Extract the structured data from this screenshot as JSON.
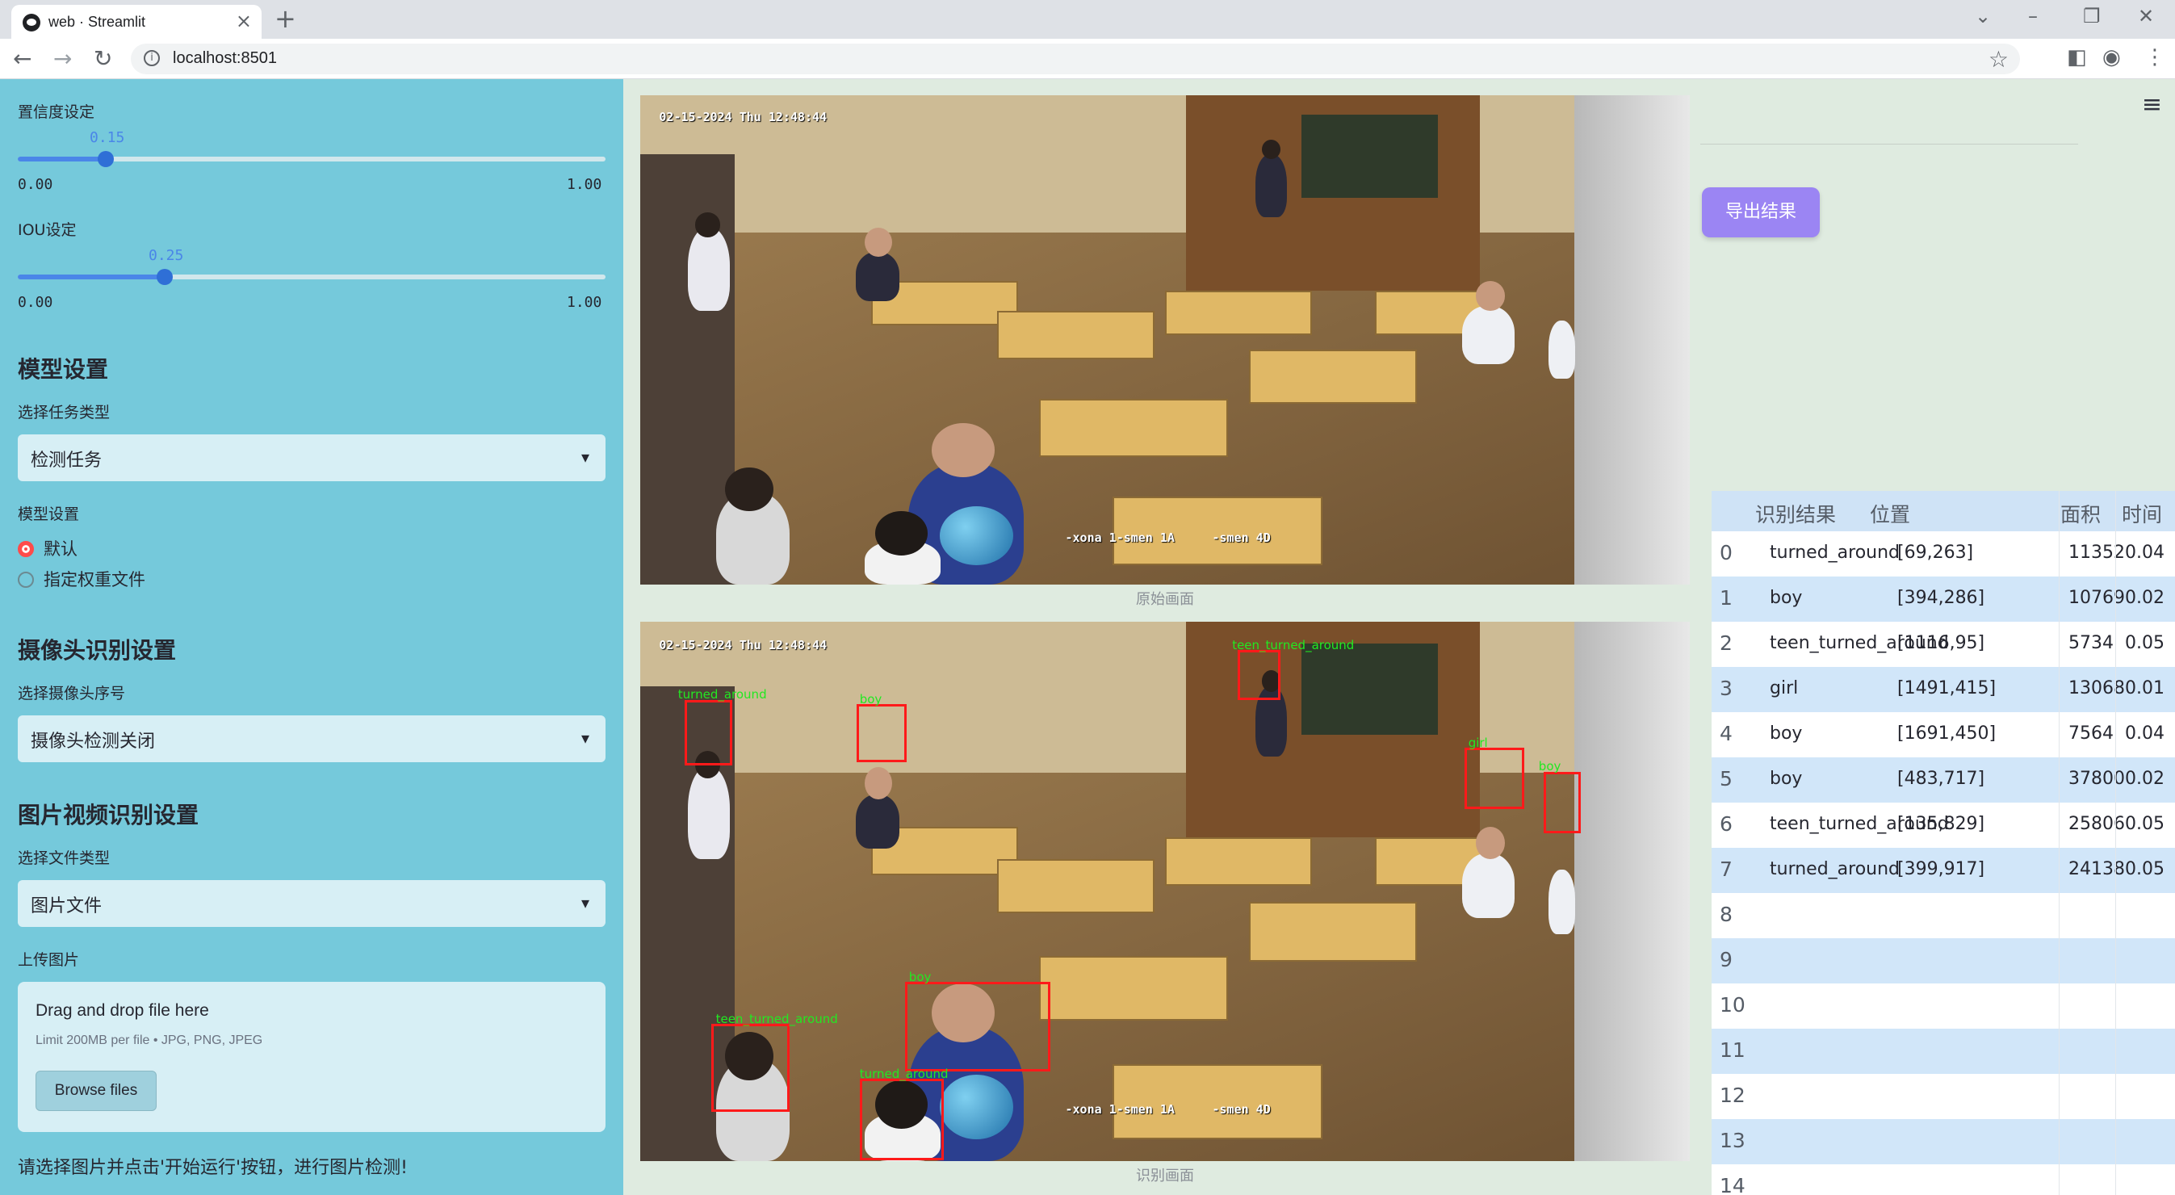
{
  "browser": {
    "tab_title": "web · Streamlit",
    "url": "localhost:8501"
  },
  "sidebar": {
    "conf_label": "置信度设定",
    "conf_value": "0.15",
    "conf_value_num": 0.15,
    "conf_min": "0.00",
    "conf_max": "1.00",
    "iou_label": "IOU设定",
    "iou_value": "0.25",
    "iou_value_num": 0.25,
    "iou_min": "0.00",
    "iou_max": "1.00",
    "model_heading": "模型设置",
    "task_label": "选择任务类型",
    "task_value": "检测任务",
    "model_label": "模型设置",
    "radio_default": "默认",
    "radio_custom": "指定权重文件",
    "camera_heading": "摄像头识别设置",
    "camera_label": "选择摄像头序号",
    "camera_value": "摄像头检测关闭",
    "media_heading": "图片视频识别设置",
    "filetype_label": "选择文件类型",
    "filetype_value": "图片文件",
    "upload_label": "上传图片",
    "upload_title": "Drag and drop file here",
    "upload_sub": "Limit 200MB per file • JPG, PNG, JPEG",
    "browse_label": "Browse files",
    "hint": "请选择图片并点击'开始运行'按钮，进行图片检测!"
  },
  "main": {
    "original_caption": "原始画面",
    "result_caption": "识别画面",
    "cam_timestamp": "02-15-2024 Thu 12:48:44",
    "cam_tag1": "-xona 1-smen 1A",
    "cam_tag2": "-smen 4D",
    "export_label": "导出结果",
    "detections": [
      {
        "label": "turned_around"
      },
      {
        "label": "boy"
      },
      {
        "label": "teen_turned_around"
      },
      {
        "label": "girl"
      },
      {
        "label": "boy"
      },
      {
        "label": "boy"
      },
      {
        "label": "teen_turned_around"
      },
      {
        "label": "turned_around"
      }
    ]
  },
  "table": {
    "headers": [
      "识别结果",
      "位置",
      "面积",
      "时间"
    ],
    "rows": [
      {
        "idx": "0",
        "result": "turned_around",
        "pos": "[69,263]",
        "area": "11352",
        "time": "0.04"
      },
      {
        "idx": "1",
        "result": "boy",
        "pos": "[394,286]",
        "area": "10769",
        "time": "0.02"
      },
      {
        "idx": "2",
        "result": "teen_turned_around",
        "pos": "[1116,95]",
        "area": "5734",
        "time": "0.05"
      },
      {
        "idx": "3",
        "result": "girl",
        "pos": "[1491,415]",
        "area": "13068",
        "time": "0.01"
      },
      {
        "idx": "4",
        "result": "boy",
        "pos": "[1691,450]",
        "area": "7564",
        "time": "0.04"
      },
      {
        "idx": "5",
        "result": "boy",
        "pos": "[483,717]",
        "area": "37800",
        "time": "0.02"
      },
      {
        "idx": "6",
        "result": "teen_turned_around",
        "pos": "[135,829]",
        "area": "25806",
        "time": "0.05"
      },
      {
        "idx": "7",
        "result": "turned_around",
        "pos": "[399,917]",
        "area": "24138",
        "time": "0.05"
      },
      {
        "idx": "8",
        "result": "",
        "pos": "",
        "area": "",
        "time": ""
      },
      {
        "idx": "9",
        "result": "",
        "pos": "",
        "area": "",
        "time": ""
      },
      {
        "idx": "10",
        "result": "",
        "pos": "",
        "area": "",
        "time": ""
      },
      {
        "idx": "11",
        "result": "",
        "pos": "",
        "area": "",
        "time": ""
      },
      {
        "idx": "12",
        "result": "",
        "pos": "",
        "area": "",
        "time": ""
      },
      {
        "idx": "13",
        "result": "",
        "pos": "",
        "area": "",
        "time": ""
      },
      {
        "idx": "14",
        "result": "",
        "pos": "",
        "area": "",
        "time": ""
      }
    ]
  },
  "colors": {
    "sidebar_bg": "#75c9db",
    "main_bg": "#dfebe0",
    "accent": "#ff4b4b",
    "export_button": "#9b85f3",
    "detection_box": "#ff1a1a",
    "detection_label": "#22e822"
  }
}
